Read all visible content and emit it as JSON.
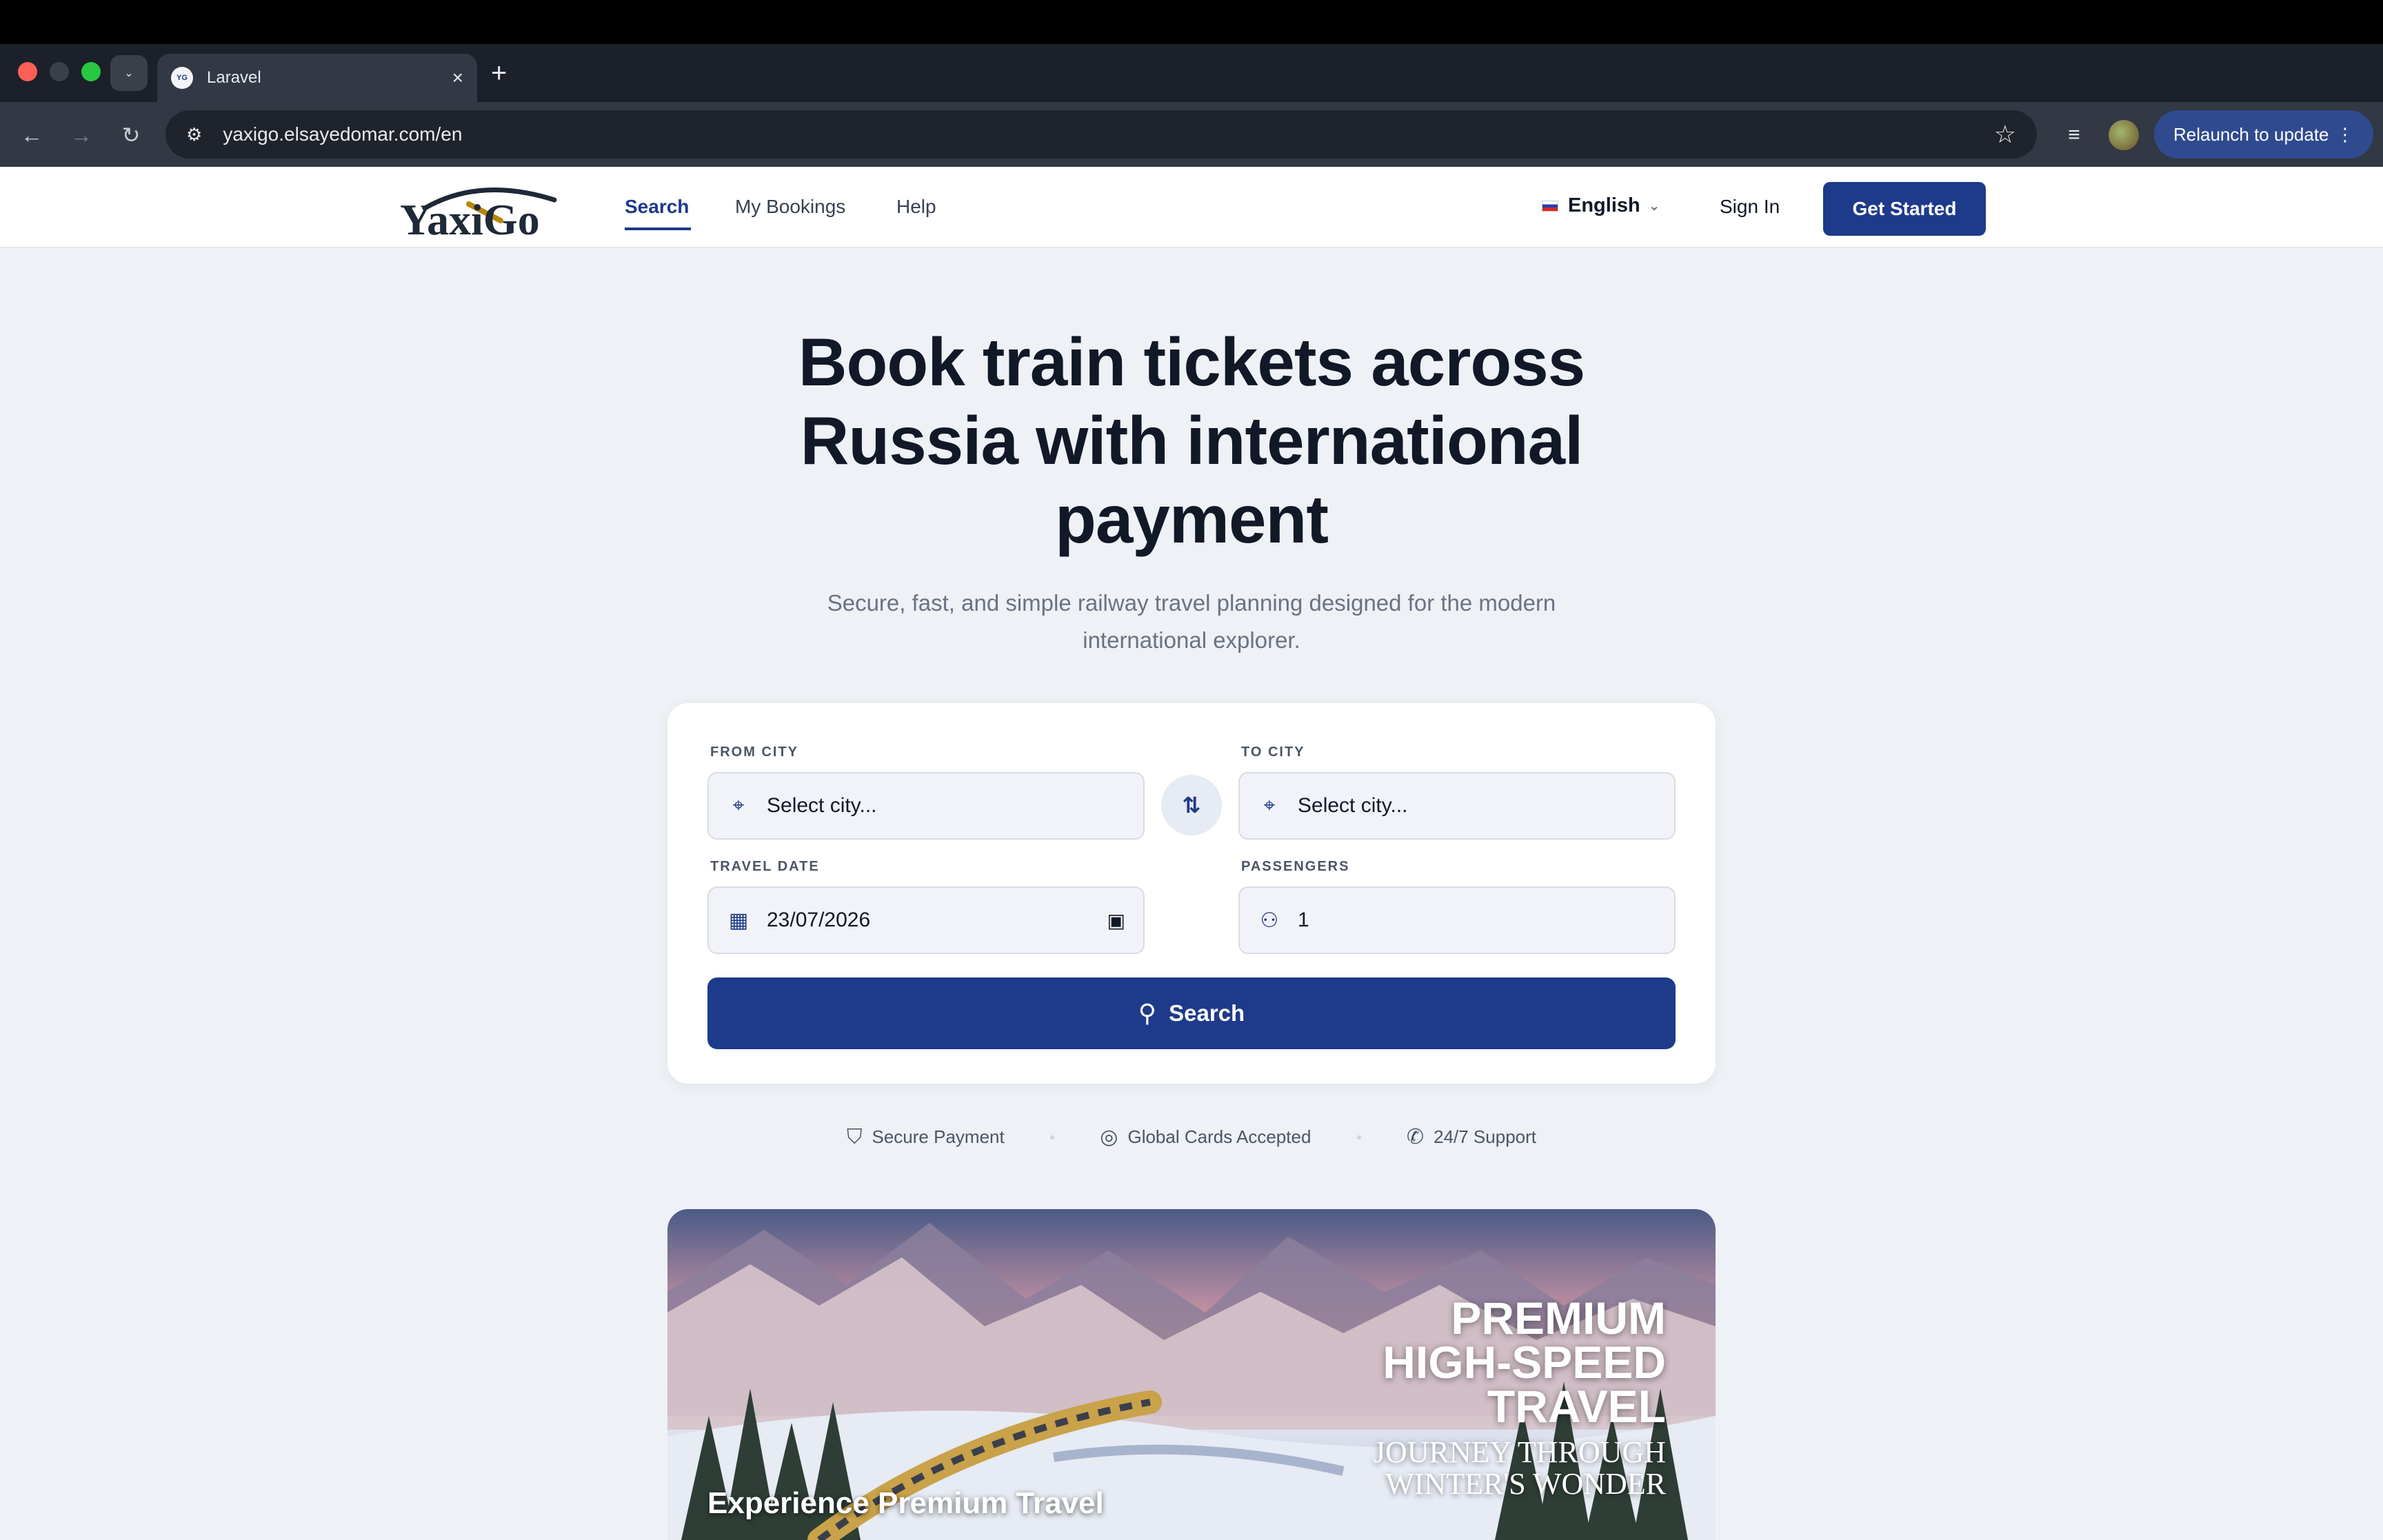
{
  "browser": {
    "tab_title": "Laravel",
    "tab_favicon_text": "YG",
    "url": "yaxigo.elsayedomar.com/en",
    "relaunch_label": "Relaunch to update"
  },
  "header": {
    "logo_text": "YaxiGo",
    "nav": [
      {
        "label": "Search"
      },
      {
        "label": "My Bookings"
      },
      {
        "label": "Help"
      }
    ],
    "language": "English",
    "sign_in": "Sign In",
    "get_started": "Get Started"
  },
  "hero": {
    "title": "Book train tickets across Russia with international payment",
    "subtitle": "Secure, fast, and simple railway travel planning designed for the modern international explorer."
  },
  "search_form": {
    "from_label": "FROM CITY",
    "from_placeholder": "Select city...",
    "to_label": "TO CITY",
    "to_placeholder": "Select city...",
    "date_label": "TRAVEL DATE",
    "date_value": "23/07/2026",
    "passengers_label": "PASSENGERS",
    "passengers_value": "1",
    "search_button": "Search"
  },
  "features": [
    {
      "label": "Secure Payment",
      "icon": "shield-icon"
    },
    {
      "label": "Global Cards Accepted",
      "icon": "globe-icon"
    },
    {
      "label": "24/7 Support",
      "icon": "phone-icon"
    }
  ],
  "banner": {
    "title_line1": "PREMIUM",
    "title_line2": "HIGH-SPEED",
    "title_line3": "TRAVEL",
    "sub_line1": "JOURNEY THROUGH",
    "sub_line2": "WINTER'S WONDER",
    "caption": "Experience Premium Travel"
  },
  "colors": {
    "brand": "#1e3a8a",
    "page_bg": "#eef1f6"
  }
}
